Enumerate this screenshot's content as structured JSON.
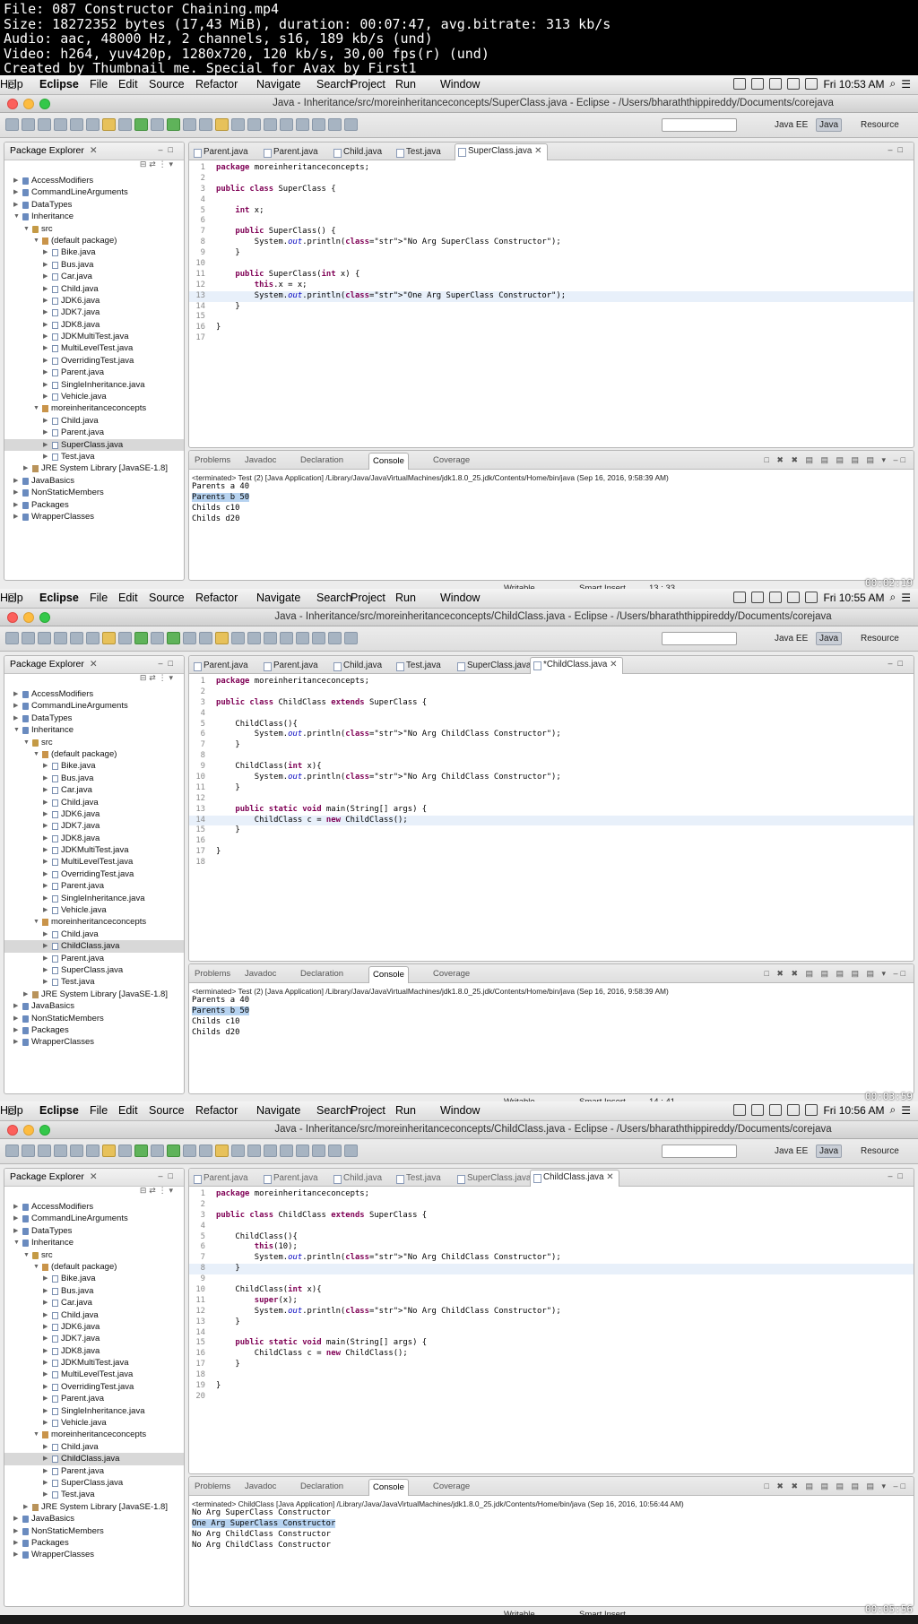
{
  "header": {
    "lines": [
      "File: 087 Constructor Chaining.mp4",
      "Size: 18272352 bytes (17,43 MiB), duration: 00:07:47, avg.bitrate: 313 kb/s",
      "Audio: aac, 48000 Hz, 2 channels, s16, 189 kb/s (und)",
      "Video: h264, yuv420p, 1280x720, 120 kb/s, 30,00 fps(r) (und)",
      "Created by Thumbnail me. Special for Avax by First1"
    ]
  },
  "menubar": {
    "app": "Eclipse",
    "items": [
      "File",
      "Edit",
      "Source",
      "Refactor",
      "Navigate",
      "Search",
      "Project",
      "Run",
      "Window",
      "Help"
    ]
  },
  "perspectives": [
    "Java EE",
    "Java",
    "Resource"
  ],
  "package_explorer": {
    "title": "Package Explorer"
  },
  "console_tabs": [
    "Problems",
    "Javadoc",
    "Declaration",
    "Console",
    "Coverage"
  ],
  "status": {
    "writable": "Writable",
    "insert": "Smart Insert"
  },
  "frames": [
    {
      "clock": "Fri 10:53 AM",
      "window_title": "Java - Inheritance/src/moreinheritanceconcepts/SuperClass.java - Eclipse - /Users/bharaththippireddy/Documents/corejava",
      "tabs": [
        "Parent.java",
        "Parent.java",
        "Child.java",
        "Test.java",
        "SuperClass.java"
      ],
      "tree": [
        "AccessModifiers",
        "CommandLineArguments",
        "DataTypes",
        "Inheritance",
        "src",
        "(default package)",
        "Bike.java",
        "Bus.java",
        "Car.java",
        "Child.java",
        "JDK6.java",
        "JDK7.java",
        "JDK8.java",
        "JDKMultiTest.java",
        "MultiLevelTest.java",
        "OverridingTest.java",
        "Parent.java",
        "SingleInheritance.java",
        "Vehicle.java",
        "moreinheritanceconcepts",
        "Child.java",
        "Parent.java",
        "SuperClass.java",
        "Test.java",
        "JRE System Library [JavaSE-1.8]",
        "JavaBasics",
        "NonStaticMembers",
        "Packages",
        "WrapperClasses"
      ],
      "code": [
        "package moreinheritanceconcepts;",
        "",
        "public class SuperClass {",
        "",
        "    int x;",
        "",
        "    public SuperClass() {",
        "        System.out.println(\"No Arg SuperClass Constructor\");",
        "    }",
        "",
        "    public SuperClass(int x) {",
        "        this.x = x;",
        "        System.out.println(\"One Arg SuperClass Constructor\");",
        "    }",
        "",
        "}",
        ""
      ],
      "console_terminated": "<terminated> Test (2) [Java Application] /Library/Java/JavaVirtualMachines/jdk1.8.0_25.jdk/Contents/Home/bin/java (Sep 16, 2016, 9:58:39 AM)",
      "console_output": [
        "Parents a 40",
        "Parents b 50",
        "Childs c10",
        "Childs d20"
      ],
      "cursor": "13 : 33",
      "timestamp": "00:02:19"
    },
    {
      "clock": "Fri 10:55 AM",
      "window_title": "Java - Inheritance/src/moreinheritanceconcepts/ChildClass.java - Eclipse - /Users/bharaththippireddy/Documents/corejava",
      "tabs": [
        "Parent.java",
        "Parent.java",
        "Child.java",
        "Test.java",
        "SuperClass.java",
        "*ChildClass.java"
      ],
      "tree": [
        "AccessModifiers",
        "CommandLineArguments",
        "DataTypes",
        "Inheritance",
        "src",
        "(default package)",
        "Bike.java",
        "Bus.java",
        "Car.java",
        "Child.java",
        "JDK6.java",
        "JDK7.java",
        "JDK8.java",
        "JDKMultiTest.java",
        "MultiLevelTest.java",
        "OverridingTest.java",
        "Parent.java",
        "SingleInheritance.java",
        "Vehicle.java",
        "moreinheritanceconcepts",
        "Child.java",
        "ChildClass.java",
        "Parent.java",
        "SuperClass.java",
        "Test.java",
        "JRE System Library [JavaSE-1.8]",
        "JavaBasics",
        "NonStaticMembers",
        "Packages",
        "WrapperClasses"
      ],
      "code": [
        "package moreinheritanceconcepts;",
        "",
        "public class ChildClass extends SuperClass {",
        "",
        "    ChildClass(){",
        "        System.out.println(\"No Arg ChildClass Constructor\");",
        "    }",
        "",
        "    ChildClass(int x){",
        "        System.out.println(\"No Arg ChildClass Constructor\");",
        "    }",
        "",
        "    public static void main(String[] args) {",
        "        ChildClass c = new ChildClass();",
        "    }",
        "",
        "}",
        ""
      ],
      "console_terminated": "<terminated> Test (2) [Java Application] /Library/Java/JavaVirtualMachines/jdk1.8.0_25.jdk/Contents/Home/bin/java (Sep 16, 2016, 9:58:39 AM)",
      "console_output": [
        "Parents a 40",
        "Parents b 50",
        "Childs c10",
        "Childs d20"
      ],
      "cursor": "14 : 41",
      "timestamp": "00:03:59"
    },
    {
      "clock": "Fri 10:56 AM",
      "window_title": "Java - Inheritance/src/moreinheritanceconcepts/ChildClass.java - Eclipse - /Users/bharaththippireddy/Documents/corejava",
      "tabs": [
        "Parent.java",
        "Parent.java",
        "Child.java",
        "Test.java",
        "SuperClass.java",
        "ChildClass.java"
      ],
      "tree": [
        "AccessModifiers",
        "CommandLineArguments",
        "DataTypes",
        "Inheritance",
        "src",
        "(default package)",
        "Bike.java",
        "Bus.java",
        "Car.java",
        "Child.java",
        "JDK6.java",
        "JDK7.java",
        "JDK8.java",
        "JDKMultiTest.java",
        "MultiLevelTest.java",
        "OverridingTest.java",
        "Parent.java",
        "SingleInheritance.java",
        "Vehicle.java",
        "moreinheritanceconcepts",
        "Child.java",
        "ChildClass.java",
        "Parent.java",
        "SuperClass.java",
        "Test.java",
        "JRE System Library [JavaSE-1.8]",
        "JavaBasics",
        "NonStaticMembers",
        "Packages",
        "WrapperClasses"
      ],
      "code": [
        "package moreinheritanceconcepts;",
        "",
        "public class ChildClass extends SuperClass {",
        "",
        "    ChildClass(){",
        "        this(10);",
        "        System.out.println(\"No Arg ChildClass Constructor\");",
        "    }",
        "",
        "    ChildClass(int x){",
        "        super(x);",
        "        System.out.println(\"No Arg ChildClass Constructor\");",
        "    }",
        "",
        "    public static void main(String[] args) {",
        "        ChildClass c = new ChildClass();",
        "    }",
        "",
        "}",
        ""
      ],
      "console_terminated": "<terminated> ChildClass [Java Application] /Library/Java/JavaVirtualMachines/jdk1.8.0_25.jdk/Contents/Home/bin/java (Sep 16, 2016, 10:56:44 AM)",
      "console_output": [
        "No Arg SuperClass Constructor",
        "One Arg SuperClass Constructor",
        "No Arg ChildClass Constructor",
        "No Arg ChildClass Constructor"
      ],
      "cursor": "",
      "timestamp": "00:05:56"
    }
  ]
}
